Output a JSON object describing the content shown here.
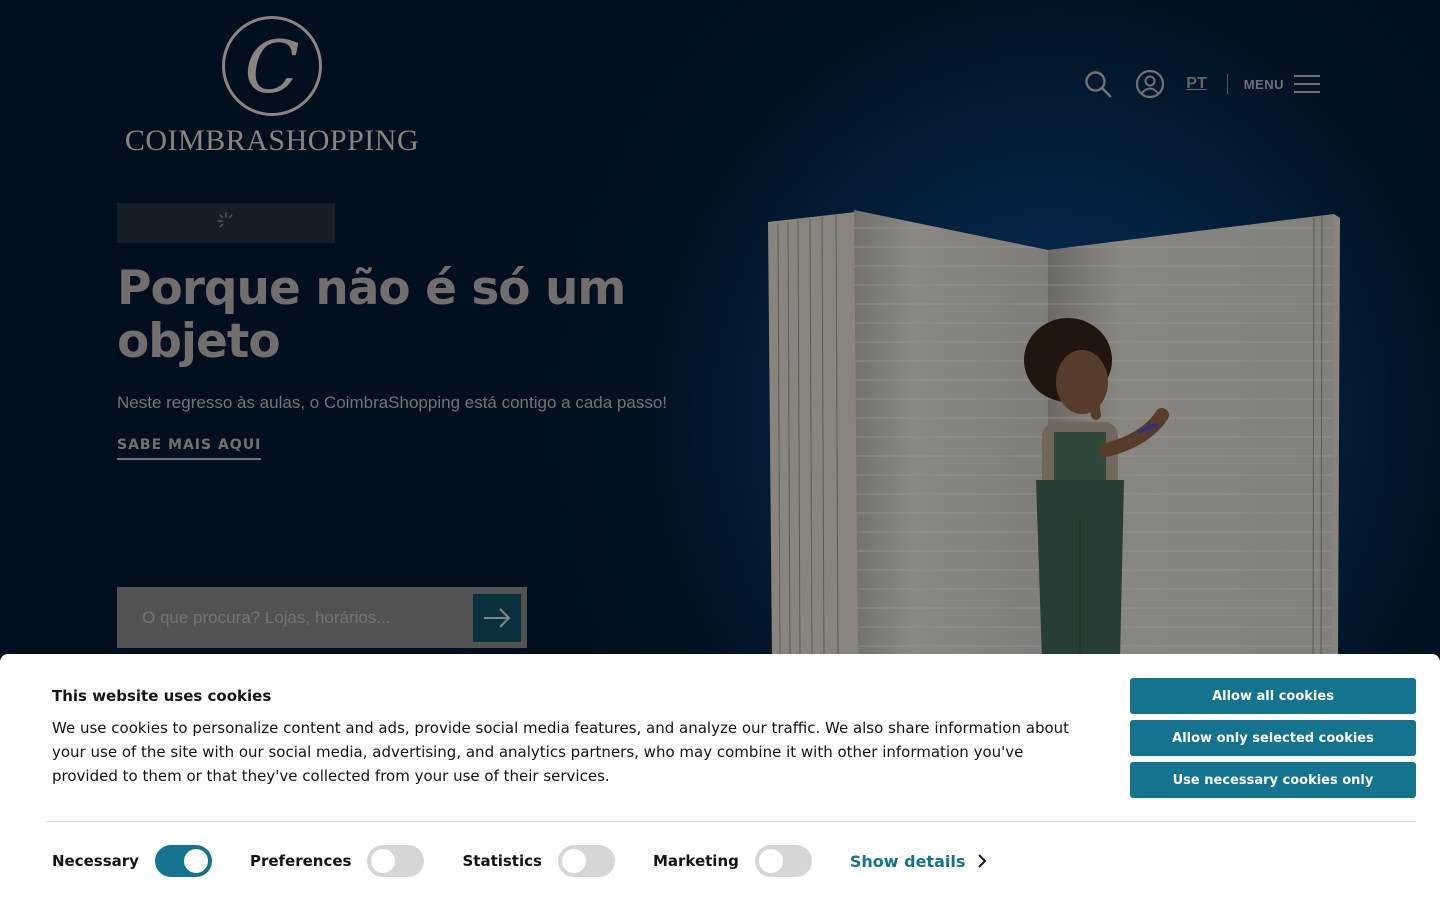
{
  "header": {
    "logo_letter": "C",
    "logo_text": "COIMBRASHOPPING",
    "language": "PT",
    "menu_label": "MENU"
  },
  "hero": {
    "title": "Porque não é só um objeto",
    "subtitle": "Neste regresso às aulas, o CoimbraShopping está contigo a cada passo!",
    "cta": "SABE MAIS AQUI"
  },
  "search": {
    "placeholder": "O que procura? Lojas, horários..."
  },
  "cookie_banner": {
    "title": "This website uses cookies",
    "body": "We use cookies to personalize content and ads, provide social media features, and analyze our traffic. We also share information about your use of the site with our social media, advertising, and analytics partners, who may combine it with other information you've provided to them or that they've collected from your use of their services.",
    "buttons": {
      "allow_all": "Allow all cookies",
      "allow_selected": "Allow only selected cookies",
      "necessary_only": "Use necessary cookies only"
    },
    "toggles": [
      {
        "label": "Necessary",
        "on": true
      },
      {
        "label": "Preferences",
        "on": false
      },
      {
        "label": "Statistics",
        "on": false
      },
      {
        "label": "Marketing",
        "on": false
      }
    ],
    "show_details": "Show details"
  },
  "colors": {
    "accent": "#14738f",
    "hero_bg": "#06274a"
  }
}
